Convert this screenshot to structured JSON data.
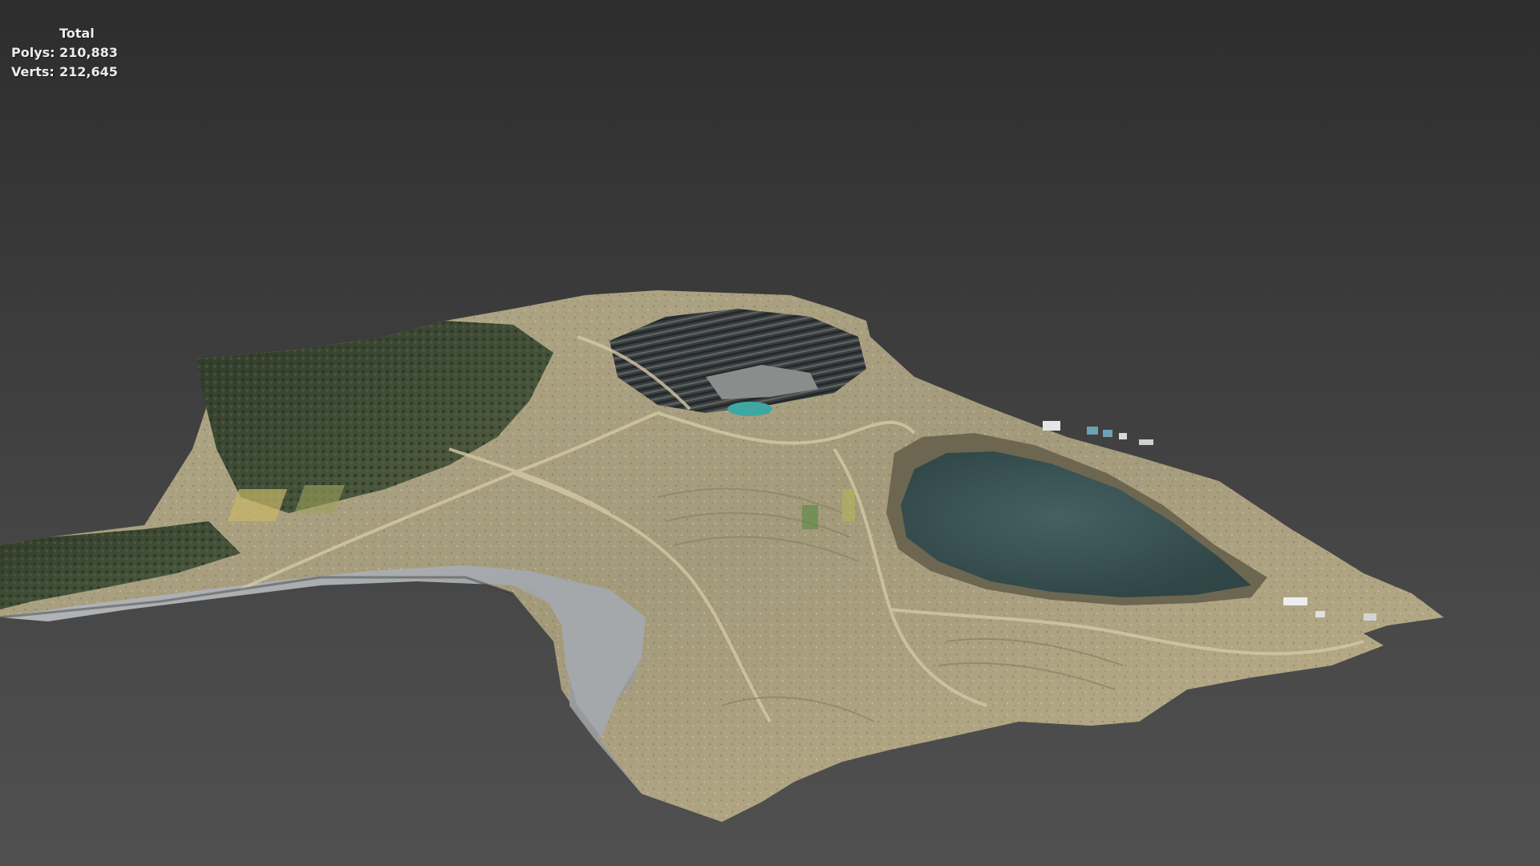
{
  "viewport": {
    "stats": {
      "title": "Total",
      "polys_label": "Polys:",
      "polys_value": "210,883",
      "verts_label": "Verts:",
      "verts_value": "212,645"
    },
    "colors": {
      "background_top": "#2d2d2d",
      "background_bottom": "#505050",
      "terrain": "#a39a7c",
      "forest": "#3e4a34",
      "tailings": "#9fa2a4",
      "pit_lake": "#3d5456",
      "small_pond": "#3fa7a1",
      "overlay_text": "#ececec"
    },
    "model_icon": "terrain-mesh-icon"
  }
}
